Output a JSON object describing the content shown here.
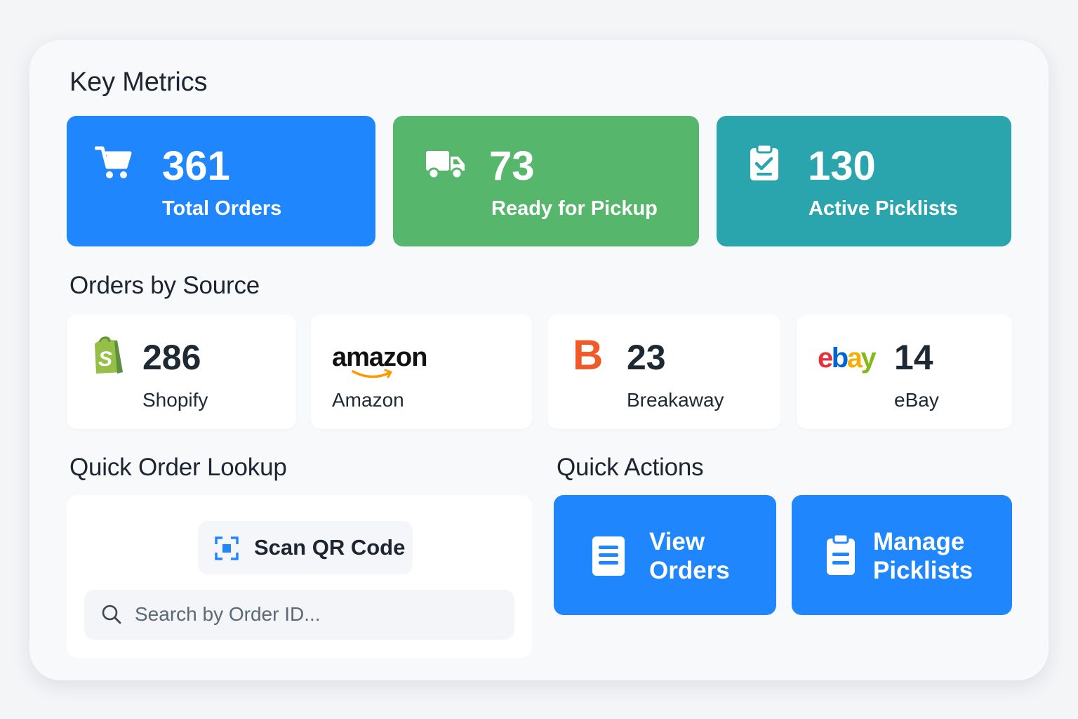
{
  "sections": {
    "key_metrics": "Key Metrics",
    "orders_by_source": "Orders by Source",
    "quick_order_lookup": "Quick Order Lookup",
    "quick_actions": "Quick Actions"
  },
  "metrics": [
    {
      "value": "361",
      "label": "Total Orders",
      "icon": "cart-icon",
      "color": "#1f86fd"
    },
    {
      "value": "73",
      "label": "Ready for Pickup",
      "icon": "truck-icon",
      "color": "#56b66c"
    },
    {
      "value": "130",
      "label": "Active Picklists",
      "icon": "clipboard-check-icon",
      "color": "#2aa4ad"
    }
  ],
  "sources": [
    {
      "value": "286",
      "label": "Shopify",
      "icon": "shopify-logo"
    },
    {
      "value": "",
      "label": "Amazon",
      "logo_text": "amazon",
      "icon": "amazon-logo"
    },
    {
      "value": "23",
      "label": "Breakaway",
      "logo_text": "B",
      "icon": "breakaway-logo"
    },
    {
      "value": "14",
      "label": "eBay",
      "logo_text": [
        "e",
        "b",
        "a",
        "y"
      ],
      "icon": "ebay-logo"
    }
  ],
  "lookup": {
    "scan_label": "Scan QR Code",
    "search_placeholder": "Search by Order ID..."
  },
  "actions": [
    {
      "line1": "View",
      "line2": "Orders",
      "icon": "document-icon"
    },
    {
      "line1": "Manage",
      "line2": "Picklists",
      "icon": "clipboard-icon"
    }
  ],
  "colors": {
    "blue": "#1f86fd",
    "green": "#56b66c",
    "teal": "#2aa4ad",
    "ebay_red": "#e53238",
    "ebay_blue": "#0064d2",
    "ebay_yellow": "#f5af02",
    "ebay_green": "#86b817",
    "amazon_orange": "#ff9900",
    "shopify_green": "#95bf47"
  }
}
